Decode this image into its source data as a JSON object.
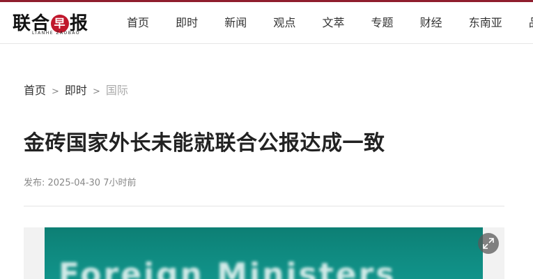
{
  "header": {
    "logo": {
      "text_left": "联合",
      "seal": "早",
      "text_right": "报",
      "subtitle": "LIANHE ZAOBAO"
    },
    "nav": [
      {
        "label": "首页"
      },
      {
        "label": "即时"
      },
      {
        "label": "新闻"
      },
      {
        "label": "观点"
      },
      {
        "label": "文萃"
      },
      {
        "label": "专题"
      },
      {
        "label": "财经"
      },
      {
        "label": "东南亚"
      },
      {
        "label": "品味"
      }
    ]
  },
  "breadcrumb": {
    "items": [
      "首页",
      "即时"
    ],
    "separator": ">",
    "current": "国际"
  },
  "article": {
    "title": "金砖国家外长未能就联合公报达成一致",
    "meta": "发布: 2025-04-30 7小时前",
    "image_caption_text": "Foreign Ministers"
  },
  "colors": {
    "brand_red": "#8f1d2d",
    "seal_red": "#c0172c",
    "photo_teal": "#0f8a80"
  },
  "icons": {
    "expand": "expand-icon"
  }
}
